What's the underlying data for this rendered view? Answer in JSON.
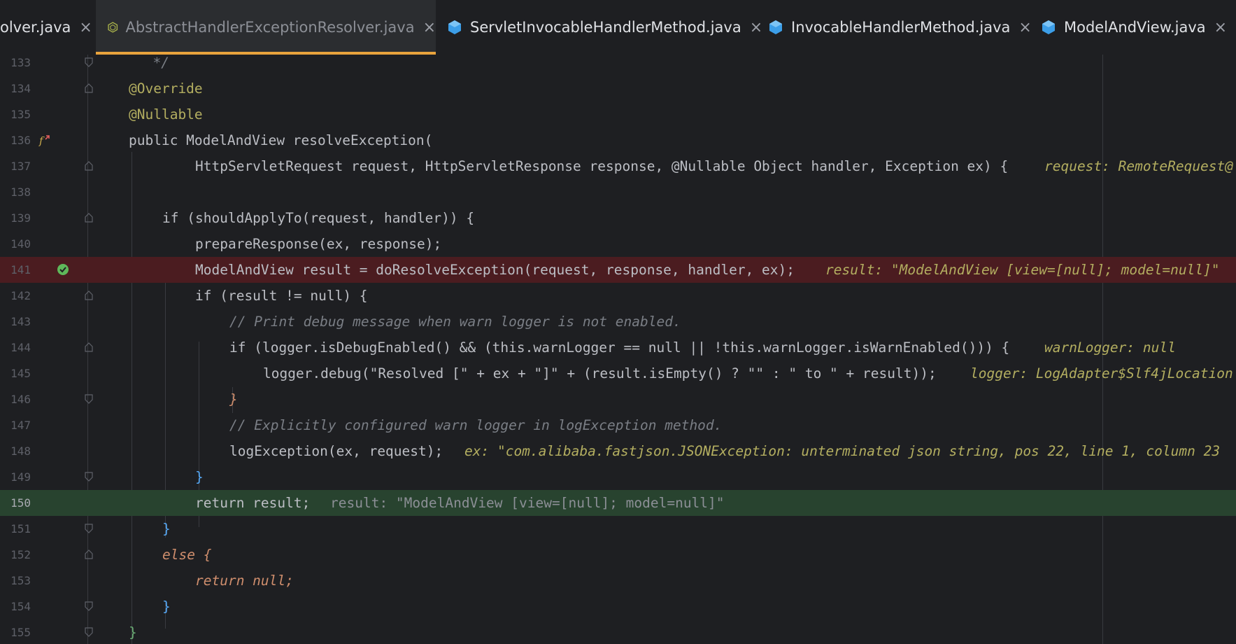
{
  "tabs": [
    {
      "label": "olver.java",
      "active": false,
      "icon": "none"
    },
    {
      "label": "AbstractHandlerExceptionResolver.java",
      "active": true,
      "icon": "abstract-class-icon"
    },
    {
      "label": "ServletInvocableHandlerMethod.java",
      "active": false,
      "icon": "class-icon"
    },
    {
      "label": "InvocableHandlerMethod.java",
      "active": false,
      "icon": "class-icon"
    },
    {
      "label": "ModelAndView.java",
      "active": false,
      "icon": "class-icon"
    }
  ],
  "close_glyph": "×",
  "colors": {
    "accent": "#e8a33d",
    "breakpoint_line": "#4b1c20",
    "execution_line": "#28432f",
    "class_icon": "#3c9ee8"
  },
  "lines": [
    {
      "num": "133",
      "text": "      */"
    },
    {
      "num": "134",
      "text": "@Override"
    },
    {
      "num": "135",
      "text": "@Nullable"
    },
    {
      "num": "136",
      "text": "public ModelAndView resolveException("
    },
    {
      "num": "137",
      "text": "HttpServletRequest request, HttpServletResponse response, @Nullable Object handler, Exception ex) {",
      "inline": "request: RemoteRequest@"
    },
    {
      "num": "138",
      "text": ""
    },
    {
      "num": "139",
      "text": "if (shouldApplyTo(request, handler)) {"
    },
    {
      "num": "140",
      "text": "prepareResponse(ex, response);"
    },
    {
      "num": "141",
      "text": "ModelAndView result = doResolveException(request, response, handler, ex);",
      "inline": "result: \"ModelAndView [view=[null]; model=null]\""
    },
    {
      "num": "142",
      "text": "if (result != null) {"
    },
    {
      "num": "143",
      "text": "// Print debug message when warn logger is not enabled."
    },
    {
      "num": "144",
      "text": "if (logger.isDebugEnabled() && (this.warnLogger == null || !this.warnLogger.isWarnEnabled())) {",
      "inline": "warnLogger: null"
    },
    {
      "num": "145",
      "text": "logger.debug(\"Resolved [\" + ex + \"]\" + (result.isEmpty() ? \"\" : \" to \" + result));",
      "inline": "logger: LogAdapter$Slf4jLocation"
    },
    {
      "num": "146",
      "text": "}"
    },
    {
      "num": "147",
      "text": "// Explicitly configured warn logger in logException method."
    },
    {
      "num": "148",
      "text": "logException(ex, request);",
      "inline": "ex: \"com.alibaba.fastjson.JSONException: unterminated json string, pos 22, line 1, column 23"
    },
    {
      "num": "149",
      "text": "}"
    },
    {
      "num": "150",
      "text": "return result;",
      "inline": "result: \"ModelAndView [view=[null]; model=null]\""
    },
    {
      "num": "151",
      "text": "}"
    },
    {
      "num": "152",
      "text": "else {"
    },
    {
      "num": "153",
      "text": "return null;"
    },
    {
      "num": "154",
      "text": "}"
    },
    {
      "num": "155",
      "text": "}"
    }
  ]
}
